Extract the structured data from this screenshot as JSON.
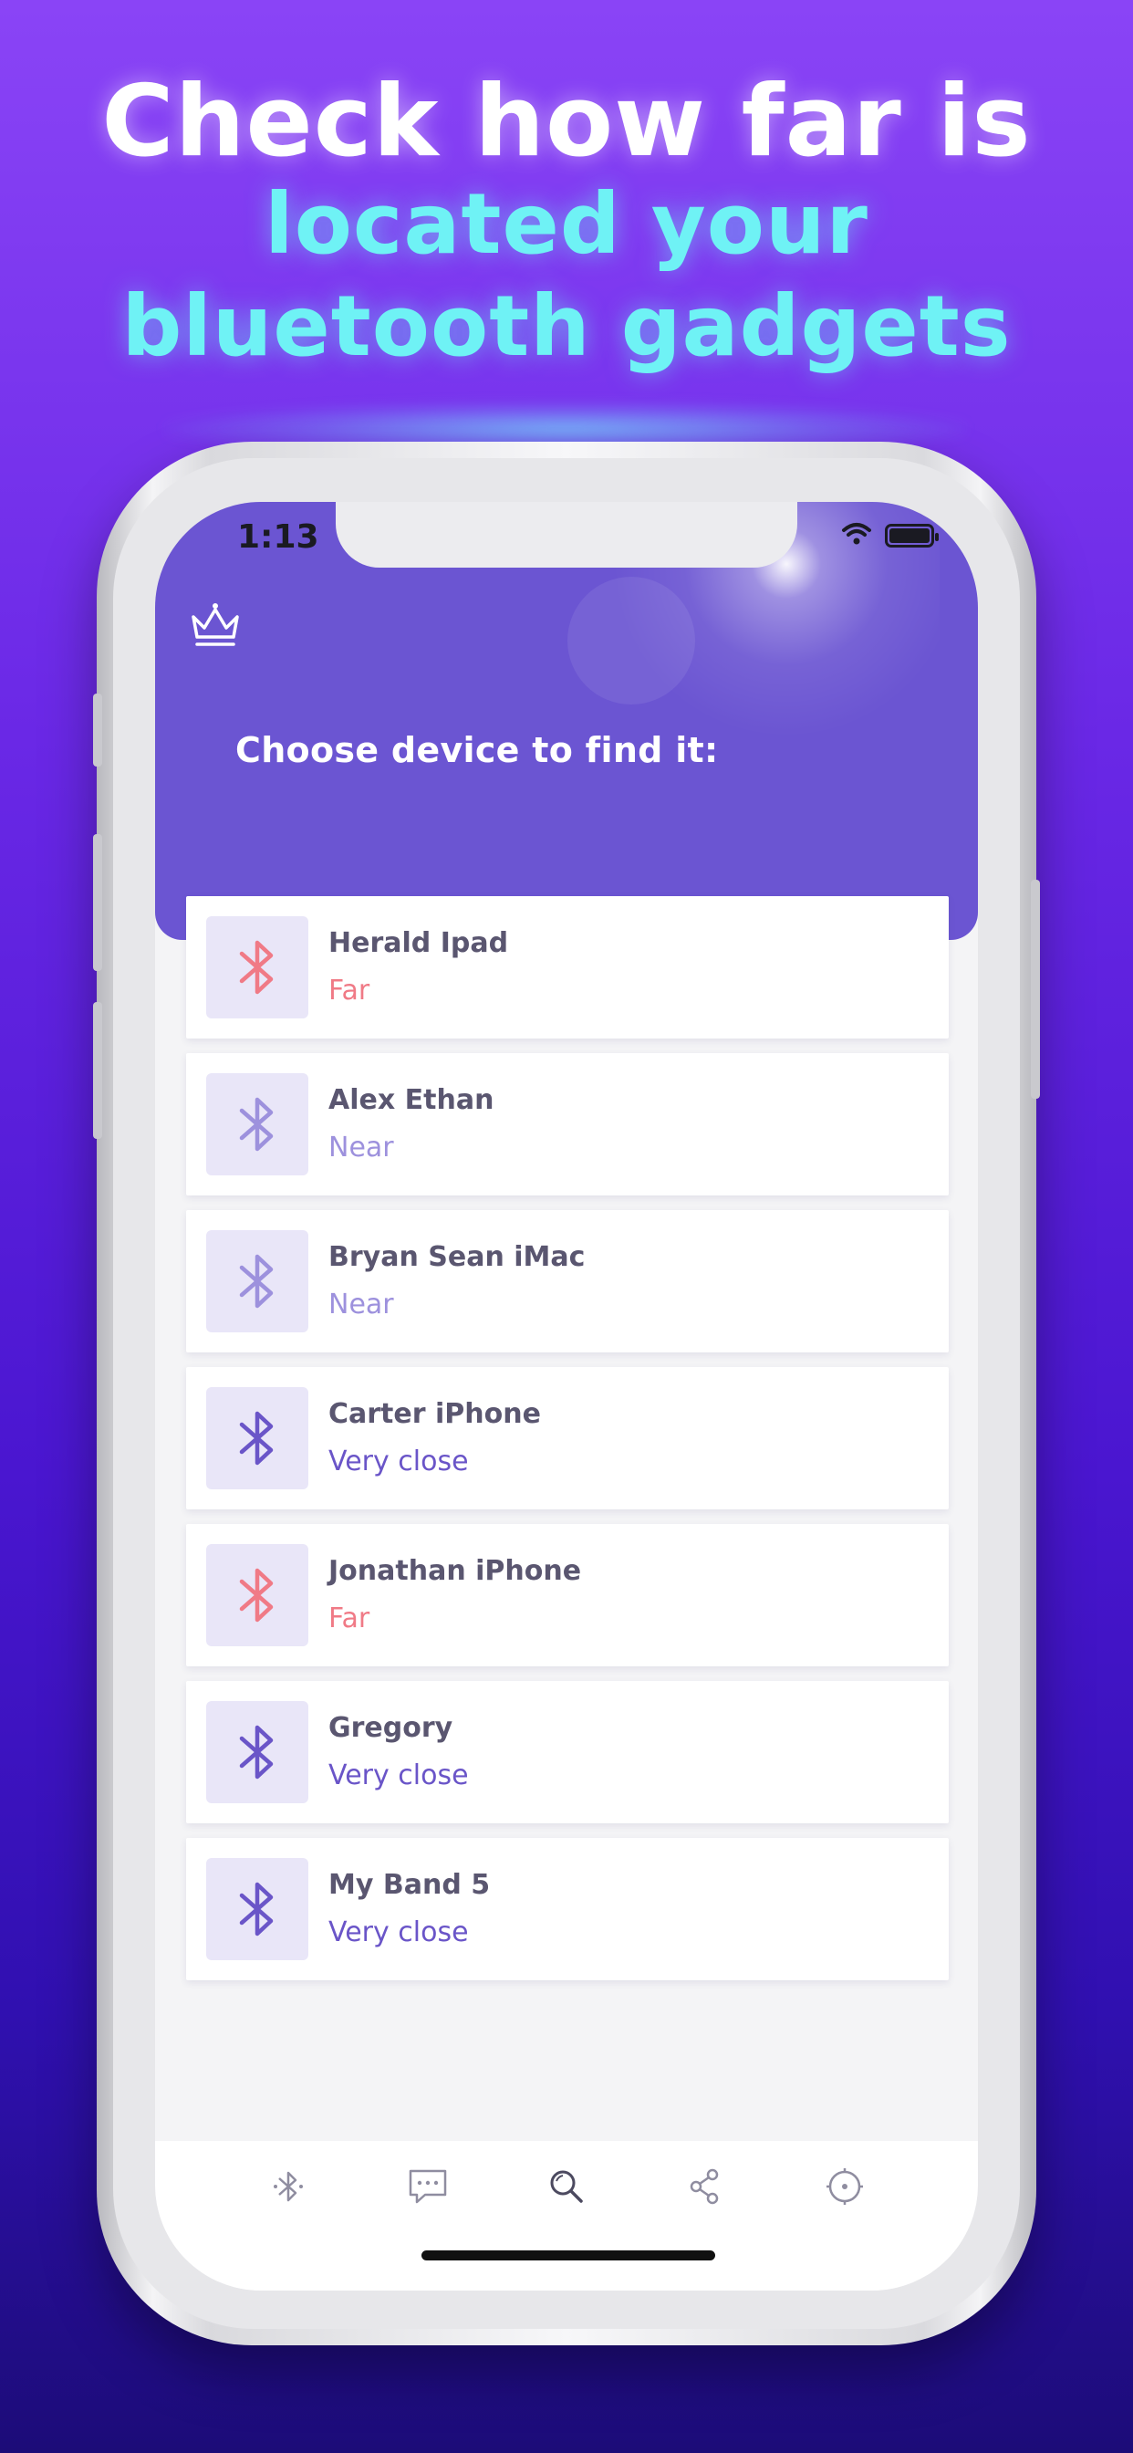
{
  "headline": {
    "line1": "Check how far is",
    "line2": "located your",
    "line3": "bluetooth gadgets"
  },
  "status_bar": {
    "time": "1:13"
  },
  "header": {
    "title": "Choose device to find it:",
    "crown_icon": "crown-icon"
  },
  "colors": {
    "far": "#f07a86",
    "near": "#9d91dd",
    "very_close": "#6a55c8",
    "header": "#6b55d2",
    "headline_accent": "#6ff2f5"
  },
  "devices": [
    {
      "name": "Herald Ipad",
      "status": "Far",
      "level": "far"
    },
    {
      "name": "Alex Ethan",
      "status": "Near",
      "level": "near"
    },
    {
      "name": "Bryan Sean iMac",
      "status": "Near",
      "level": "near"
    },
    {
      "name": "Carter iPhone",
      "status": "Very close",
      "level": "very_close"
    },
    {
      "name": "Jonathan iPhone",
      "status": "Far",
      "level": "far"
    },
    {
      "name": "Gregory",
      "status": "Very close",
      "level": "very_close"
    },
    {
      "name": "My Band 5",
      "status": "Very close",
      "level": "very_close"
    }
  ],
  "tabbar": {
    "items": [
      "bluetooth-icon",
      "chat-icon",
      "search-icon",
      "share-icon",
      "compass-icon"
    ],
    "active": "search-icon"
  }
}
